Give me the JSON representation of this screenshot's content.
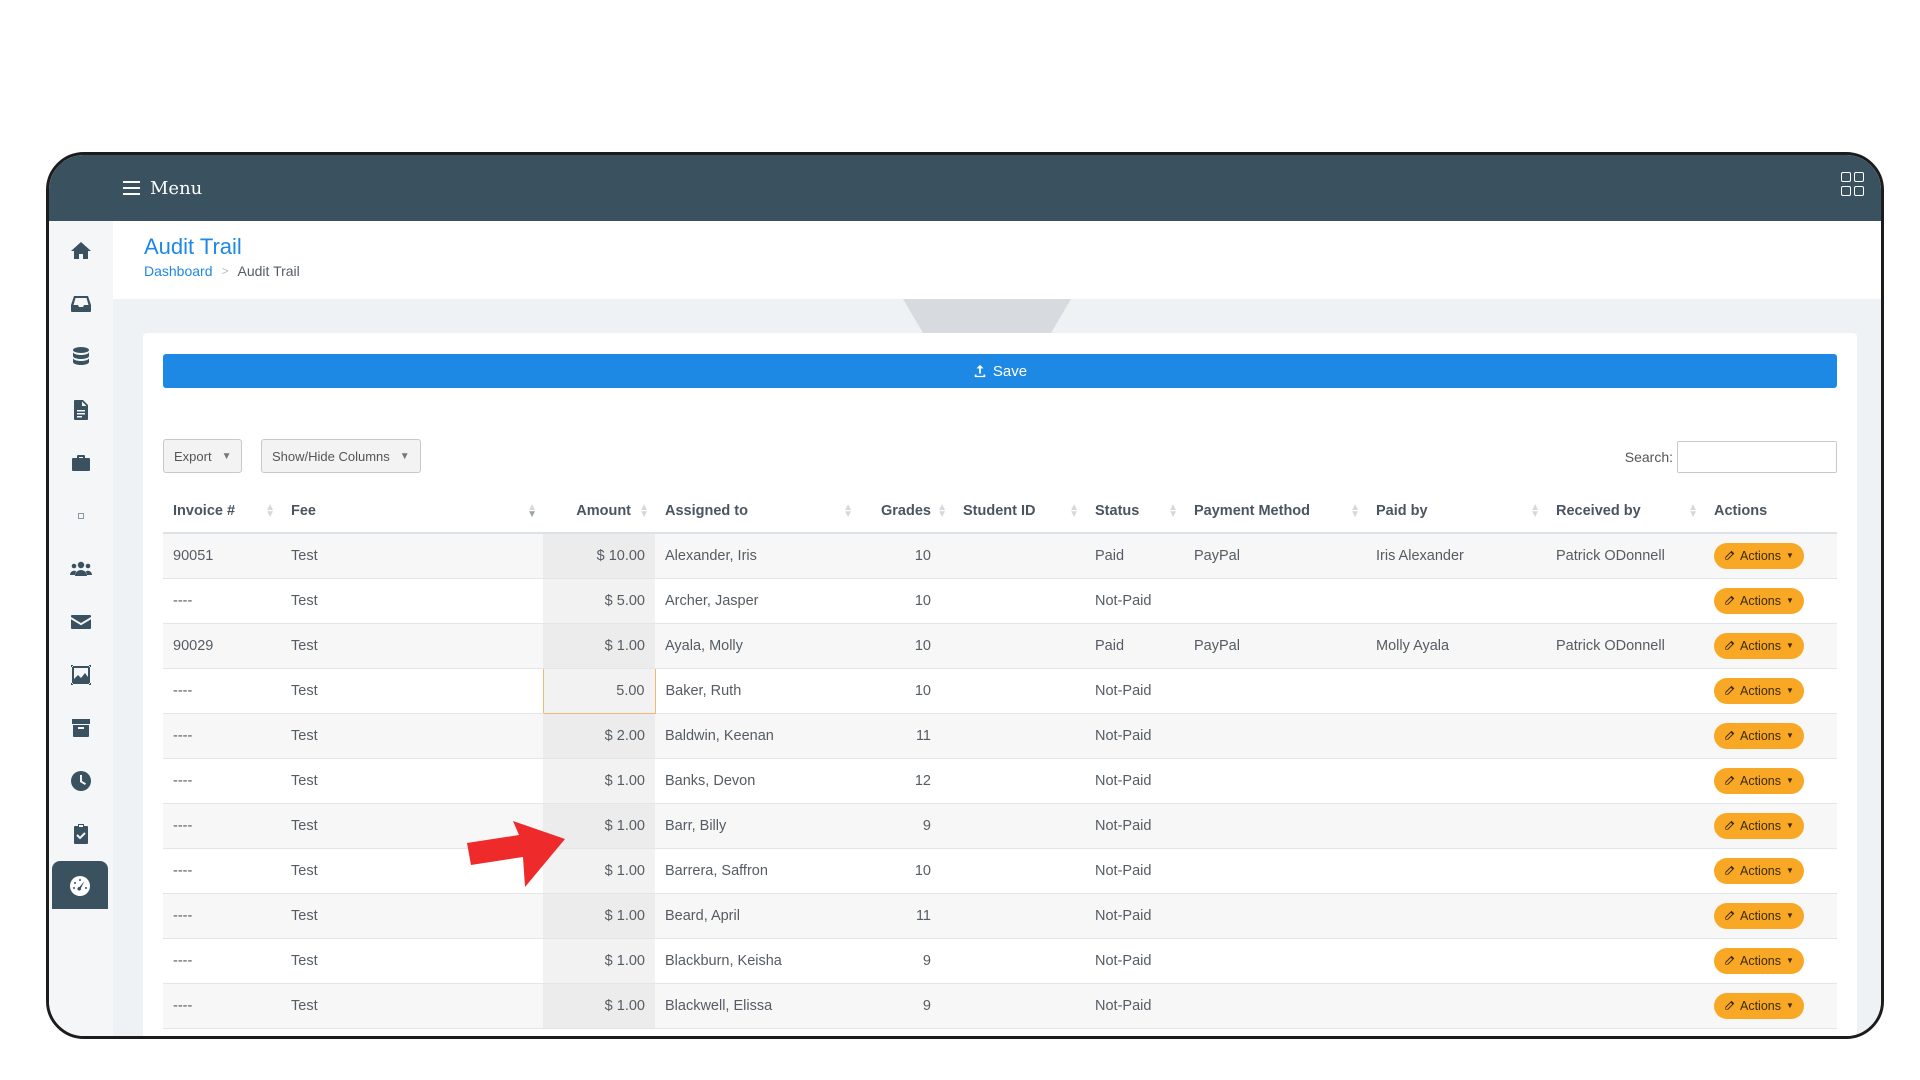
{
  "topbar": {
    "menu_label": "Menu"
  },
  "sidebar": {
    "items": [
      {
        "icon": "home-icon"
      },
      {
        "icon": "inbox-icon"
      },
      {
        "icon": "database-icon"
      },
      {
        "icon": "document-icon"
      },
      {
        "icon": "briefcase-icon"
      },
      {
        "icon": "small-square-icon"
      },
      {
        "icon": "users-icon"
      },
      {
        "icon": "envelope-icon"
      },
      {
        "icon": "image-gallery-icon"
      },
      {
        "icon": "archive-icon"
      },
      {
        "icon": "clock-icon"
      },
      {
        "icon": "clipboard-check-icon"
      },
      {
        "icon": "dashboard-gauge-icon"
      }
    ]
  },
  "header": {
    "title": "Audit Trail",
    "breadcrumb": {
      "link": "Dashboard",
      "separator": ">",
      "current": "Audit Trail"
    }
  },
  "toolbar": {
    "save_label": "Save",
    "export_label": "Export",
    "columns_label": "Show/Hide Columns",
    "search_label": "Search:",
    "search_value": ""
  },
  "table": {
    "columns": [
      "Invoice #",
      "Fee",
      "Amount",
      "Assigned to",
      "Grades",
      "Student ID",
      "Status",
      "Payment Method",
      "Paid by",
      "Received by",
      "Actions"
    ],
    "action_label": "Actions",
    "rows": [
      {
        "invoice": "90051",
        "fee": "Test",
        "amount": "$ 10.00",
        "assigned": "Alexander, Iris",
        "grades": "10",
        "student_id": "",
        "status": "Paid",
        "method": "PayPal",
        "paid_by": "Iris Alexander",
        "received_by": "Patrick ODonnell"
      },
      {
        "invoice": "----",
        "fee": "Test",
        "amount": "$ 5.00",
        "assigned": "Archer, Jasper",
        "grades": "10",
        "student_id": "",
        "status": "Not-Paid",
        "method": "",
        "paid_by": "",
        "received_by": ""
      },
      {
        "invoice": "90029",
        "fee": "Test",
        "amount": "$ 1.00",
        "assigned": "Ayala, Molly",
        "grades": "10",
        "student_id": "",
        "status": "Paid",
        "method": "PayPal",
        "paid_by": "Molly Ayala",
        "received_by": "Patrick ODonnell"
      },
      {
        "invoice": "----",
        "fee": "Test",
        "amount": "5.00",
        "assigned": "Baker, Ruth",
        "grades": "10",
        "student_id": "",
        "status": "Not-Paid",
        "method": "",
        "paid_by": "",
        "received_by": ""
      },
      {
        "invoice": "----",
        "fee": "Test",
        "amount": "$ 2.00",
        "assigned": "Baldwin, Keenan",
        "grades": "11",
        "student_id": "",
        "status": "Not-Paid",
        "method": "",
        "paid_by": "",
        "received_by": ""
      },
      {
        "invoice": "----",
        "fee": "Test",
        "amount": "$ 1.00",
        "assigned": "Banks, Devon",
        "grades": "12",
        "student_id": "",
        "status": "Not-Paid",
        "method": "",
        "paid_by": "",
        "received_by": ""
      },
      {
        "invoice": "----",
        "fee": "Test",
        "amount": "$ 1.00",
        "assigned": "Barr, Billy",
        "grades": "9",
        "student_id": "",
        "status": "Not-Paid",
        "method": "",
        "paid_by": "",
        "received_by": ""
      },
      {
        "invoice": "----",
        "fee": "Test",
        "amount": "$ 1.00",
        "assigned": "Barrera, Saffron",
        "grades": "10",
        "student_id": "",
        "status": "Not-Paid",
        "method": "",
        "paid_by": "",
        "received_by": ""
      },
      {
        "invoice": "----",
        "fee": "Test",
        "amount": "$ 1.00",
        "assigned": "Beard, April",
        "grades": "11",
        "student_id": "",
        "status": "Not-Paid",
        "method": "",
        "paid_by": "",
        "received_by": ""
      },
      {
        "invoice": "----",
        "fee": "Test",
        "amount": "$ 1.00",
        "assigned": "Blackburn, Keisha",
        "grades": "9",
        "student_id": "",
        "status": "Not-Paid",
        "method": "",
        "paid_by": "",
        "received_by": ""
      },
      {
        "invoice": "----",
        "fee": "Test",
        "amount": "$ 1.00",
        "assigned": "Blackwell, Elissa",
        "grades": "9",
        "student_id": "",
        "status": "Not-Paid",
        "method": "",
        "paid_by": "",
        "received_by": ""
      }
    ]
  },
  "colors": {
    "topbar": "#3a5260",
    "accent": "#1e88e5",
    "actions": "#f9a825",
    "arrow": "#ee2a2a"
  }
}
